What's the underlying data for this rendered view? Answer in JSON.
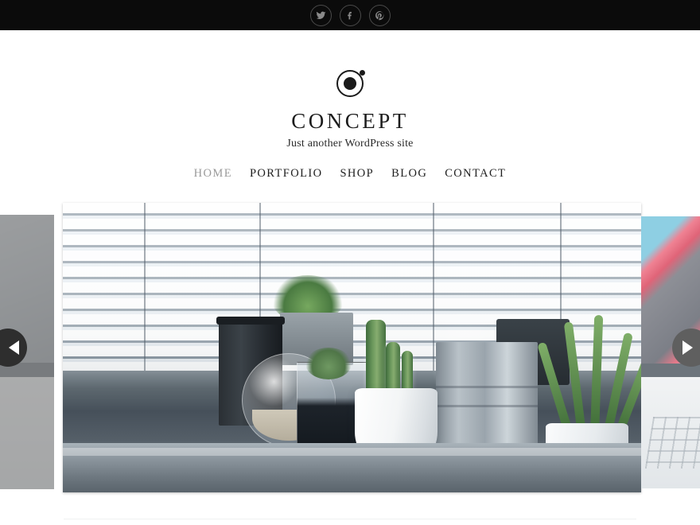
{
  "topbar": {
    "social": [
      {
        "name": "twitter",
        "label": "Twitter",
        "glyph": "twitter-icon"
      },
      {
        "name": "facebook",
        "label": "Facebook",
        "glyph": "facebook-icon"
      },
      {
        "name": "pinterest",
        "label": "Pinterest",
        "glyph": "pinterest-icon"
      }
    ],
    "background_color": "#0b0b0b",
    "icon_color": "#8a8a8a"
  },
  "branding": {
    "logo_name": "concept-orbit-logo",
    "title": "CONCEPT",
    "tagline": "Just another WordPress site",
    "title_color": "#1c1c1c"
  },
  "nav": {
    "items": [
      {
        "label": "HOME",
        "active": true
      },
      {
        "label": "PORTFOLIO",
        "active": false
      },
      {
        "label": "SHOP",
        "active": false
      },
      {
        "label": "BLOG",
        "active": false
      },
      {
        "label": "CONTACT",
        "active": false
      }
    ],
    "active_color": "#9a9a9a",
    "link_color": "#1e1e1e"
  },
  "slider": {
    "prev_arrow_label": "Previous slide",
    "next_arrow_label": "Next slide",
    "prev_arrow_color": "#2e2e2e",
    "next_arrow_color": "#5f5f5f",
    "slides": [
      {
        "position": "previous",
        "alt": "Blurred grey office interior",
        "state": "dimmed"
      },
      {
        "position": "active",
        "alt": "Cactus and succulent plants in pots on a windowsill with venetian blinds",
        "state": "visible"
      },
      {
        "position": "next",
        "alt": "Laptop with colourful abstract artwork on screen beside a keyboard",
        "state": "visible"
      }
    ]
  }
}
